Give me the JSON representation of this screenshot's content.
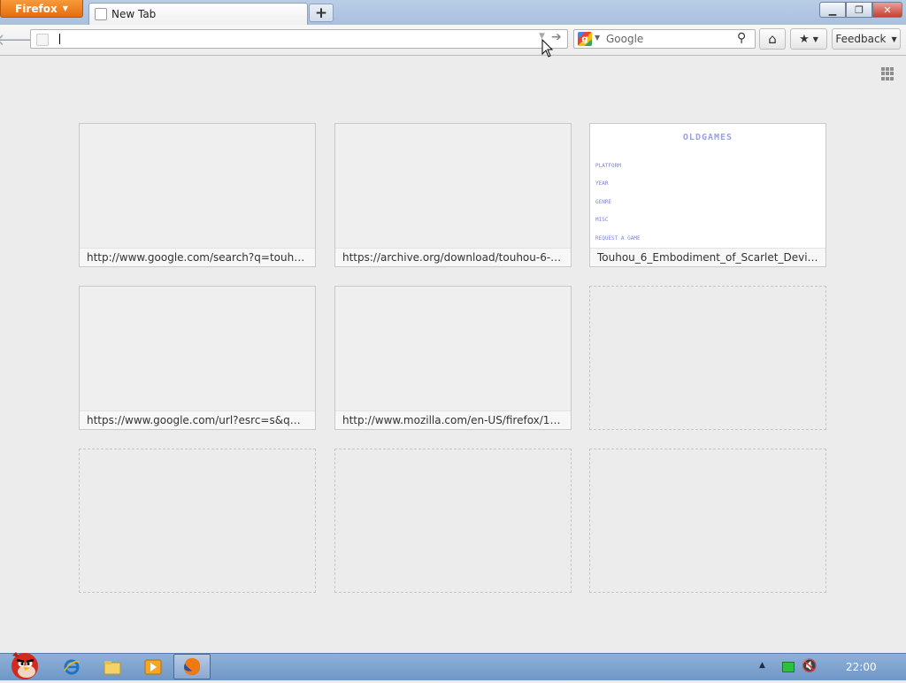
{
  "titlebar": {
    "app_button_label": "Firefox",
    "active_tab_title": "New Tab",
    "new_tab_symbol": "+"
  },
  "toolbar": {
    "url_value": "",
    "search_placeholder": "Google",
    "feedback_label": "Feedback"
  },
  "newtab": {
    "tiles": [
      {
        "caption": "http://www.google.com/search?q=touhou+6..."
      },
      {
        "caption": "https://archive.org/download/touhou-6-emb..."
      },
      {
        "caption": "Touhou_6_Embodiment_of_Scarlet_Devil_Win..."
      },
      {
        "caption": "https://www.google.com/url?esrc=s&q=&rct..."
      },
      {
        "caption": "http://www.mozilla.com/en-US/firefox/13.0/f..."
      }
    ],
    "thumbnail_text": {
      "title": "OLDGAMES",
      "links": [
        "PLATFORM",
        "YEAR",
        "GENRE",
        "MISC",
        "REQUEST A GAME"
      ]
    }
  },
  "taskbar": {
    "clock": "22:00"
  },
  "colors": {
    "firefox_button": "#e56d0e",
    "titlebar": "#a9c0de",
    "taskbar": "#6f96c6",
    "close_button": "#c7402f"
  }
}
